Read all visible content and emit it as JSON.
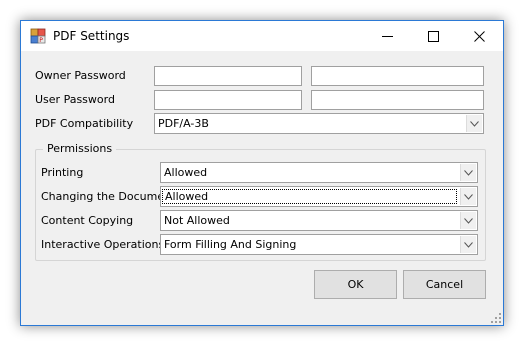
{
  "window": {
    "title": "PDF Settings",
    "icons": {
      "app": "pdf-app-icon",
      "minimize": "minimize-icon",
      "maximize": "maximize-icon",
      "close": "close-icon"
    }
  },
  "security": {
    "owner_password_label": "Owner Password",
    "user_password_label": "User Password",
    "owner_password_value": "",
    "owner_password_confirm_value": "",
    "user_password_value": "",
    "user_password_confirm_value": ""
  },
  "compatibility": {
    "label": "PDF Compatibility",
    "value": "PDF/A-3B"
  },
  "permissions": {
    "title": "Permissions",
    "printing": {
      "label": "Printing",
      "value": "Allowed"
    },
    "changing": {
      "label": "Changing the Document",
      "value": "Allowed"
    },
    "copying": {
      "label": "Content Copying",
      "value": "Not Allowed"
    },
    "interactive": {
      "label": "Interactive Operations",
      "value": "Form Filling And Signing"
    }
  },
  "buttons": {
    "ok": "OK",
    "cancel": "Cancel"
  }
}
